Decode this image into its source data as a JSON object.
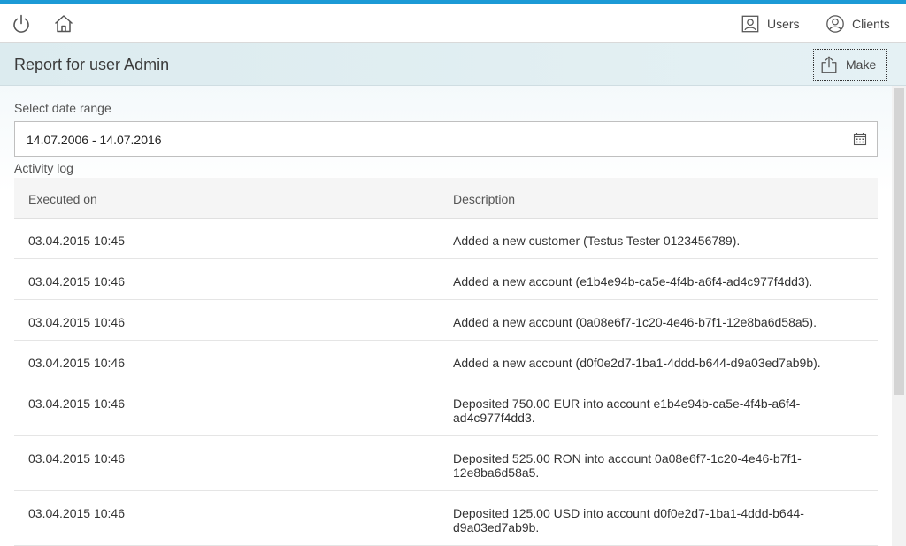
{
  "topbar": {
    "power_icon": "power-icon",
    "home_icon": "home-icon",
    "users_label": "Users",
    "clients_label": "Clients"
  },
  "header": {
    "title": "Report for user Admin",
    "make_label": "Make"
  },
  "date_range": {
    "label": "Select date range",
    "value": "14.07.2006  -  14.07.2016"
  },
  "activity": {
    "label": "Activity log",
    "columns": [
      "Executed on",
      "Description"
    ],
    "rows": [
      {
        "date": "03.04.2015 10:45",
        "desc": "Added a new customer (Testus Tester 0123456789)."
      },
      {
        "date": "03.04.2015 10:46",
        "desc": "Added a new account (e1b4e94b-ca5e-4f4b-a6f4-ad4c977f4dd3)."
      },
      {
        "date": "03.04.2015 10:46",
        "desc": "Added a new account (0a08e6f7-1c20-4e46-b7f1-12e8ba6d58a5)."
      },
      {
        "date": "03.04.2015 10:46",
        "desc": "Added a new account (d0f0e2d7-1ba1-4ddd-b644-d9a03ed7ab9b)."
      },
      {
        "date": "03.04.2015 10:46",
        "desc": "Deposited 750.00 EUR into account e1b4e94b-ca5e-4f4b-a6f4-ad4c977f4dd3."
      },
      {
        "date": "03.04.2015 10:46",
        "desc": "Deposited 525.00 RON into account 0a08e6f7-1c20-4e46-b7f1-12e8ba6d58a5."
      },
      {
        "date": "03.04.2015 10:46",
        "desc": "Deposited 125.00 USD into account d0f0e2d7-1ba1-4ddd-b644-d9a03ed7ab9b."
      }
    ]
  },
  "colors": {
    "accent": "#1c9ad6",
    "subheader_bg": "#dcebef"
  }
}
